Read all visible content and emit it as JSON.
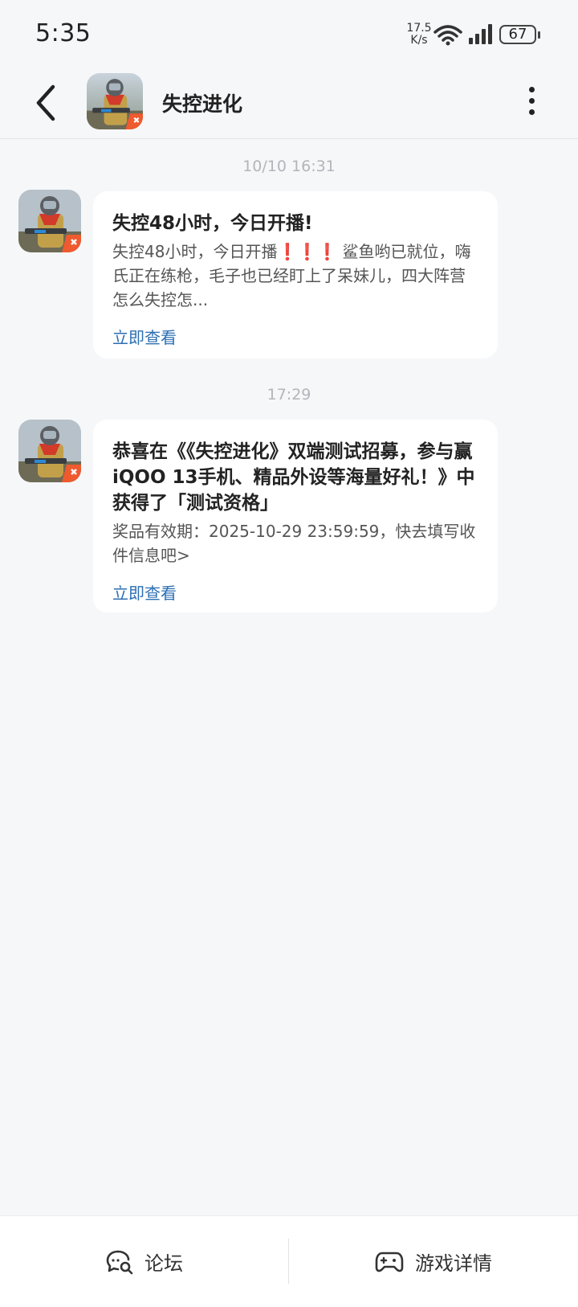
{
  "status_bar": {
    "time": "5:35",
    "net_speed_value": "17.5",
    "net_speed_unit": "K/s",
    "battery": "67"
  },
  "header": {
    "title": "失控进化"
  },
  "messages": [
    {
      "timestamp": "10/10  16:31",
      "title": "失控48小时，今日开播!",
      "body_before": "失控48小时，今日开播",
      "body_emphasis": "❗❗❗",
      "body_after": "鲨鱼哟已就位，嗨氏正在练枪，毛子也已经盯上了呆妹儿，四大阵营怎么失控怎...",
      "link": "立即查看"
    },
    {
      "timestamp": "17:29",
      "title": "恭喜在《《失控进化》双端测试招募，参与赢iQOO 13手机、精品外设等海量好礼！》中获得了「测试资格」",
      "body": "奖品有效期：2025-10-29 23:59:59，快去填写收件信息吧>",
      "link": "立即查看"
    }
  ],
  "bottom_bar": {
    "forum_label": "论坛",
    "game_details_label": "游戏详情"
  },
  "colors": {
    "background": "#f6f7f9",
    "link": "#2c6fb3",
    "timestamp": "#b3b5ba"
  },
  "icons": [
    "back-arrow-icon",
    "more-vertical-icon",
    "forum-chat-icon",
    "gamepad-icon",
    "wifi-icon",
    "signal-icon",
    "battery-icon"
  ]
}
